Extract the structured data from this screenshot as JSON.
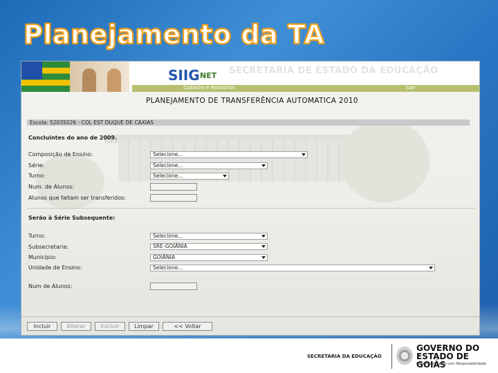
{
  "slide": {
    "title": "Planejamento da TA"
  },
  "header": {
    "logo": "SIIG",
    "logo_net": "NET",
    "secretaria": "SECRETARIA DE ESTADO DA EDUCAÇÃO",
    "menu_left": "Cadastro e Relatórios",
    "menu_right": "Sair"
  },
  "form": {
    "title": "PLANEJAMENTO DE TRANSFERÊNCIA AUTOMATICA 2010",
    "escola": "Escola: 52035026 - COL EST DUQUE DE CAXIAS",
    "section1": "Concluintes do ano de 2009.",
    "section2": "Serão à Série Subsequente:",
    "labels": {
      "composicao": "Composição de Ensino:",
      "serie": "Série:",
      "turno1": "Turno:",
      "num_alunos1": "Num. de Alunos:",
      "alunos_faltam": "Alunos que faltam ser transferidos:",
      "turno2": "Turno:",
      "subsecretaria": "Subsecretaria:",
      "municipio": "Município:",
      "unidade": "Unidade de Ensino:",
      "num_alunos2": "Num de Alunos:"
    },
    "values": {
      "composicao": "Selecione...",
      "serie": "Selecione...",
      "turno1": "Selecione...",
      "turno2": "Selecione...",
      "subsecretaria": "SRE-GOIÂNIA",
      "municipio": "GOIÂNIA",
      "unidade": "Selecione..."
    },
    "buttons": {
      "incluir": "Incluir",
      "alterar": "Alterar",
      "excluir": "Excluir",
      "limpar": "Limpar",
      "voltar": "<< Voltar"
    }
  },
  "footer": {
    "secretaria": "SECRETARIA DA EDUCAÇÃO",
    "gov_line1": "GOVERNO DO",
    "gov_line2": "ESTADO DE GOIÁS",
    "gov_line3": "Desenvolvimento com Responsabilidade"
  }
}
